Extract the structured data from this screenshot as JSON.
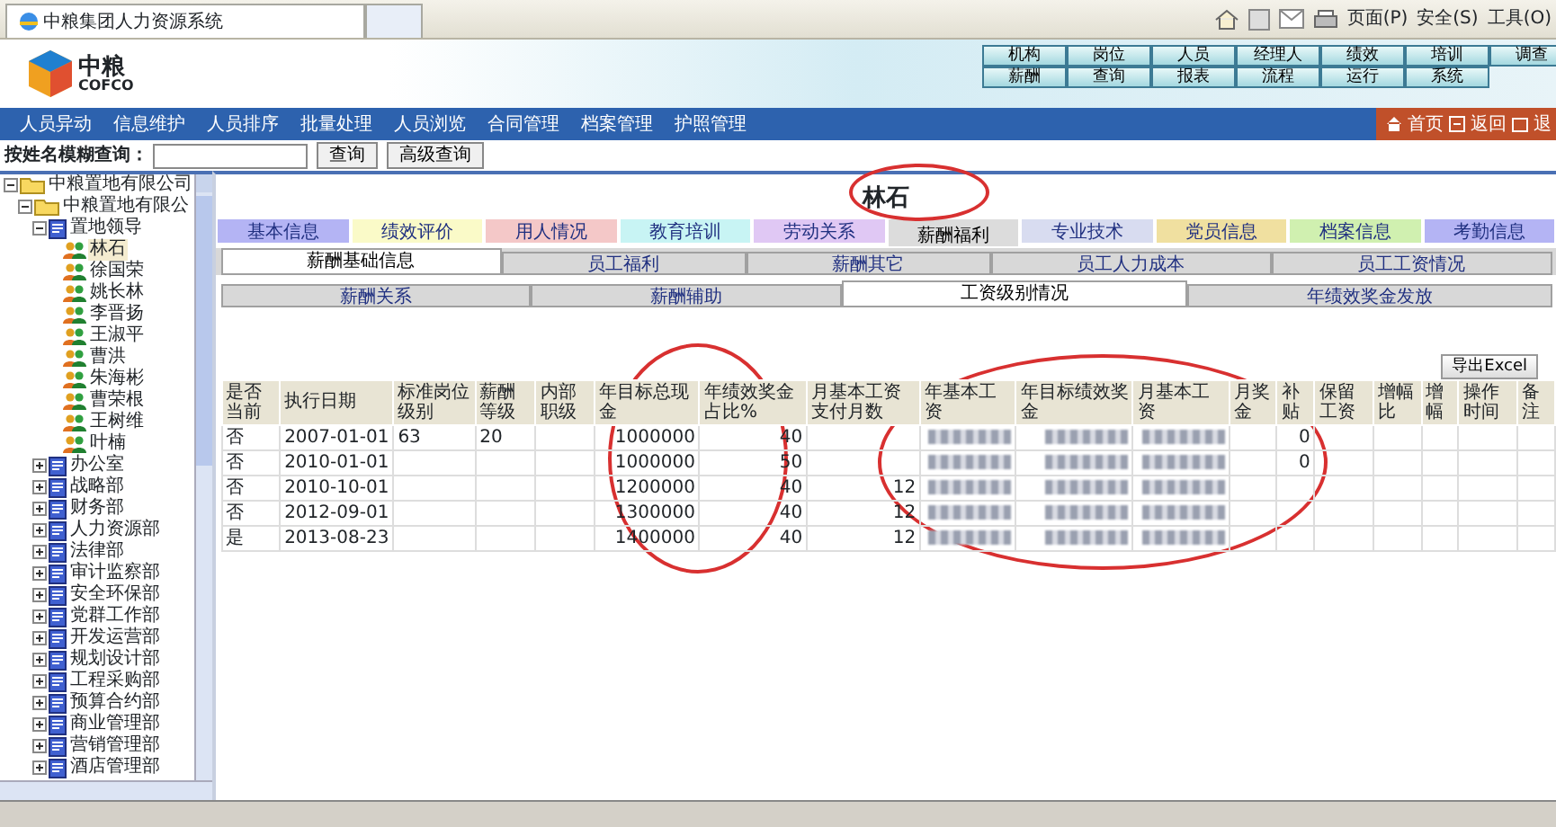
{
  "browser": {
    "tab_title": "中粮集团人力资源系统",
    "toolbar": [
      "页面(P)",
      "安全(S)",
      "工具(O)"
    ]
  },
  "header": {
    "logo_text": "中粮",
    "logo_sub": "COFCO",
    "menu_rows": [
      [
        "机构",
        "岗位",
        "人员",
        "经理人",
        "绩效",
        "培训",
        "调查"
      ],
      [
        "薪酬",
        "查询",
        "报表",
        "流程",
        "运行",
        "系统"
      ]
    ]
  },
  "nav": {
    "items": [
      "人员异动",
      "信息维护",
      "人员排序",
      "批量处理",
      "人员浏览",
      "合同管理",
      "档案管理",
      "护照管理"
    ],
    "quick_links": [
      "首页",
      "返回",
      "退"
    ]
  },
  "search": {
    "label": "按姓名模糊查询：",
    "buttons": [
      "查询",
      "高级查询"
    ]
  },
  "tree": [
    {
      "label": "中粮置地有限公司",
      "kind": "company",
      "expanded": true,
      "selected": false,
      "children": [
        {
          "label": "中粮置地有限公",
          "kind": "company",
          "expanded": true,
          "selected": false,
          "children": [
            {
              "label": "置地领导",
              "kind": "department",
              "expanded": true,
              "selected": false,
              "children": [
                {
                  "label": "林石",
                  "kind": "person",
                  "selected": true
                },
                {
                  "label": "徐国荣",
                  "kind": "person",
                  "selected": false
                },
                {
                  "label": "姚长林",
                  "kind": "person",
                  "selected": false
                },
                {
                  "label": "李晋扬",
                  "kind": "person",
                  "selected": false
                },
                {
                  "label": "王淑平",
                  "kind": "person",
                  "selected": false
                },
                {
                  "label": "曹洪",
                  "kind": "person",
                  "selected": false
                },
                {
                  "label": "朱海彬",
                  "kind": "person",
                  "selected": false
                },
                {
                  "label": "曹荣根",
                  "kind": "person",
                  "selected": false
                },
                {
                  "label": "王树维",
                  "kind": "person",
                  "selected": false
                },
                {
                  "label": "叶楠",
                  "kind": "person",
                  "selected": false
                }
              ]
            },
            {
              "label": "办公室",
              "kind": "department",
              "expanded": false,
              "selected": false
            },
            {
              "label": "战略部",
              "kind": "department",
              "expanded": false,
              "selected": false
            },
            {
              "label": "财务部",
              "kind": "department",
              "expanded": false,
              "selected": false
            },
            {
              "label": "人力资源部",
              "kind": "department",
              "expanded": false,
              "selected": false
            },
            {
              "label": "法律部",
              "kind": "department",
              "expanded": false,
              "selected": false
            },
            {
              "label": "审计监察部",
              "kind": "department",
              "expanded": false,
              "selected": false
            },
            {
              "label": "安全环保部",
              "kind": "department",
              "expanded": false,
              "selected": false
            },
            {
              "label": "党群工作部",
              "kind": "department",
              "expanded": false,
              "selected": false
            },
            {
              "label": "开发运营部",
              "kind": "department",
              "expanded": false,
              "selected": false
            },
            {
              "label": "规划设计部",
              "kind": "department",
              "expanded": false,
              "selected": false
            },
            {
              "label": "工程采购部",
              "kind": "department",
              "expanded": false,
              "selected": false
            },
            {
              "label": "预算合约部",
              "kind": "department",
              "expanded": false,
              "selected": false
            },
            {
              "label": "商业管理部",
              "kind": "department",
              "expanded": false,
              "selected": false
            },
            {
              "label": "营销管理部",
              "kind": "department",
              "expanded": false,
              "selected": false
            },
            {
              "label": "酒店管理部",
              "kind": "department",
              "expanded": false,
              "selected": false
            }
          ]
        }
      ]
    }
  ],
  "employee_name": "林石",
  "category_tabs": [
    {
      "label": "基本信息",
      "color": "#b4b4f4",
      "selected": false
    },
    {
      "label": "绩效评价",
      "color": "#fafac8",
      "selected": false
    },
    {
      "label": "用人情况",
      "color": "#f4c8c8",
      "selected": false
    },
    {
      "label": "教育培训",
      "color": "#c8f4f4",
      "selected": false
    },
    {
      "label": "劳动关系",
      "color": "#e0c8f4",
      "selected": false
    },
    {
      "label": "薪酬福利",
      "color": "#dcdcdc",
      "selected": true
    },
    {
      "label": "专业技术",
      "color": "#d8dcf0",
      "selected": false
    },
    {
      "label": "党员信息",
      "color": "#f0e0a0",
      "selected": false
    },
    {
      "label": "档案信息",
      "color": "#d0f0b0",
      "selected": false
    },
    {
      "label": "考勤信息",
      "color": "#b4b4f4",
      "selected": false
    }
  ],
  "sub_tabs": [
    {
      "label": "薪酬基础信息",
      "selected": true
    },
    {
      "label": "员工福利",
      "selected": false
    },
    {
      "label": "薪酬其它",
      "selected": false
    },
    {
      "label": "员工人力成本",
      "selected": false
    },
    {
      "label": "员工工资情况",
      "selected": false
    }
  ],
  "detail_tabs": [
    {
      "label": "薪酬关系",
      "selected": false
    },
    {
      "label": "薪酬辅助",
      "selected": false
    },
    {
      "label": "工资级别情况",
      "selected": true
    },
    {
      "label": "年绩效奖金发放",
      "selected": false
    }
  ],
  "export_button": "导出Excel",
  "table": {
    "columns": [
      "是否当前",
      "执行日期",
      "标准岗位级别",
      "薪酬等级",
      "内部职级",
      "年目标总现金",
      "年绩效奖金占比%",
      "月基本工资支付月数",
      "年基本工资",
      "年目标绩效奖金",
      "月基本工资",
      "月奖金",
      "补贴",
      "保留工资",
      "增幅比",
      "增幅",
      "操作时间",
      "备注"
    ],
    "rows": [
      {
        "cells": [
          "否",
          "2007-01-01",
          "63",
          "20",
          null,
          "1000000",
          "40",
          null,
          {
            "blurred": true
          },
          {
            "blurred": true
          },
          {
            "blurred": true
          },
          null,
          "0",
          null,
          null,
          null,
          null,
          null
        ]
      },
      {
        "cells": [
          "否",
          "2010-01-01",
          null,
          null,
          null,
          "1000000",
          "50",
          null,
          {
            "blurred": true
          },
          {
            "blurred": true
          },
          {
            "blurred": true
          },
          null,
          "0",
          null,
          null,
          null,
          null,
          null
        ]
      },
      {
        "cells": [
          "否",
          "2010-10-01",
          null,
          null,
          null,
          "1200000",
          "40",
          "12",
          {
            "blurred": true
          },
          {
            "blurred": true
          },
          {
            "blurred": true
          },
          null,
          null,
          null,
          null,
          null,
          null,
          null
        ]
      },
      {
        "cells": [
          "否",
          "2012-09-01",
          null,
          null,
          null,
          "1300000",
          "40",
          "12",
          {
            "blurred": true
          },
          {
            "blurred": true
          },
          {
            "blurred": true
          },
          null,
          null,
          null,
          null,
          null,
          null,
          null
        ]
      },
      {
        "cells": [
          "是",
          "2013-08-23",
          null,
          null,
          null,
          "1400000",
          "40",
          "12",
          {
            "blurred": true
          },
          {
            "blurred": true
          },
          {
            "blurred": true
          },
          null,
          null,
          null,
          null,
          null,
          null,
          null
        ]
      }
    ]
  },
  "annotations": [
    {
      "kind": "ellipse"
    },
    {
      "kind": "ellipse"
    },
    {
      "kind": "ellipse"
    }
  ]
}
